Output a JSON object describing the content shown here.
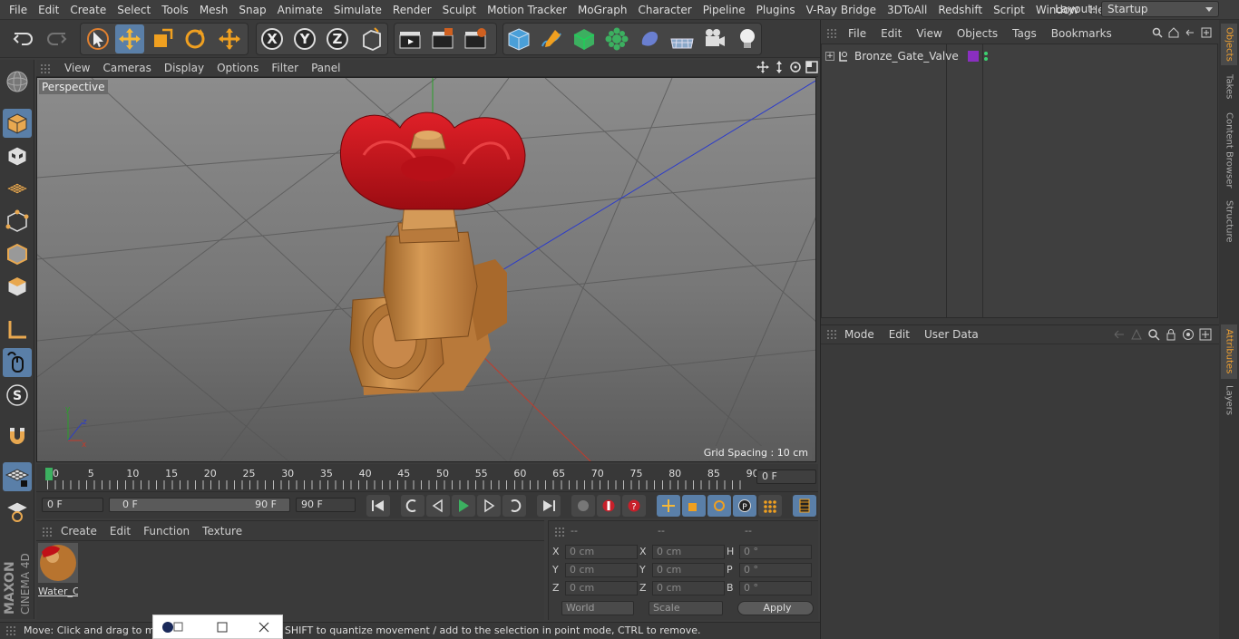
{
  "menu": [
    "File",
    "Edit",
    "Create",
    "Select",
    "Tools",
    "Mesh",
    "Snap",
    "Animate",
    "Simulate",
    "Render",
    "Sculpt",
    "Motion Tracker",
    "MoGraph",
    "Character",
    "Pipeline",
    "Plugins",
    "V-Ray Bridge",
    "3DToAll",
    "Redshift",
    "Script",
    "Window",
    "Help"
  ],
  "layout": {
    "label": "Layout:",
    "value": "Startup"
  },
  "viewport": {
    "menu": [
      "View",
      "Cameras",
      "Display",
      "Options",
      "Filter",
      "Panel"
    ],
    "camera_label": "Perspective",
    "grid_spacing": "Grid Spacing : 10 cm"
  },
  "timeline": {
    "ticks": [
      "0",
      "5",
      "10",
      "15",
      "20",
      "25",
      "30",
      "35",
      "40",
      "45",
      "50",
      "55",
      "60",
      "65",
      "70",
      "75",
      "80",
      "85",
      "90"
    ],
    "current_frame": "0 F",
    "start_frame": "0 F",
    "range_start": "0 F",
    "range_end": "90 F",
    "end_frame": "90 F"
  },
  "material_manager": {
    "menu": [
      "Create",
      "Edit",
      "Function",
      "Texture"
    ],
    "material_name": "Water_C"
  },
  "coordinates": {
    "headers": [
      "--",
      "--",
      "--"
    ],
    "rows": [
      {
        "a_label": "X",
        "a_val": "0 cm",
        "b_label": "X",
        "b_val": "0 cm",
        "c_label": "H",
        "c_val": "0 °"
      },
      {
        "a_label": "Y",
        "a_val": "0 cm",
        "b_label": "Y",
        "b_val": "0 cm",
        "c_label": "P",
        "c_val": "0 °"
      },
      {
        "a_label": "Z",
        "a_val": "0 cm",
        "b_label": "Z",
        "b_val": "0 cm",
        "c_label": "B",
        "c_val": "0 °"
      }
    ],
    "world": "World",
    "scale": "Scale",
    "apply": "Apply"
  },
  "status": "Move: Click and drag to move elements. Hold down SHIFT to quantize movement / add to the selection in point mode, CTRL to remove.",
  "object_manager": {
    "menu": [
      "File",
      "Edit",
      "View",
      "Objects",
      "Tags",
      "Bookmarks"
    ],
    "object_name": "Bronze_Gate_Valve"
  },
  "attributes": {
    "menu": [
      "Mode",
      "Edit",
      "User Data"
    ]
  },
  "side_tabs": [
    "Objects",
    "Takes",
    "Content Browser",
    "Structure",
    "Attributes",
    "Layers"
  ],
  "branding": {
    "maxon": "MAXON",
    "product": "CINEMA 4D"
  },
  "colors": {
    "accent": "#5a7fa8",
    "valve_handle": "#c8101a",
    "valve_body": "#c8863f",
    "tab_selected": "#f0a030"
  }
}
